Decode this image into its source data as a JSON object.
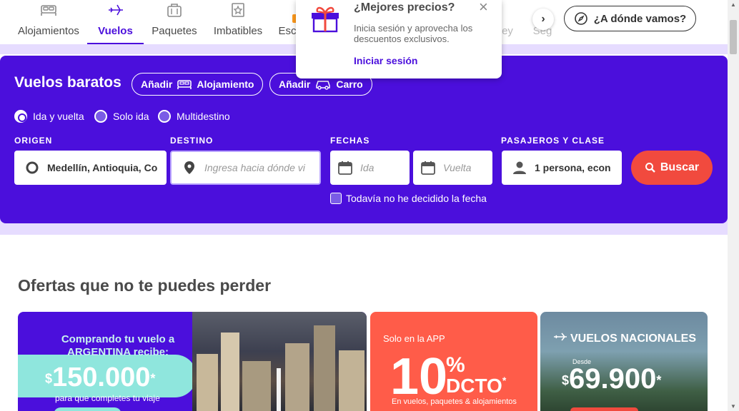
{
  "nav": {
    "items": [
      {
        "label": "Alojamientos",
        "icon": "bed-icon"
      },
      {
        "label": "Vuelos",
        "icon": "plane-icon",
        "active": true
      },
      {
        "label": "Paquetes",
        "icon": "luggage-icon"
      },
      {
        "label": "Imbatibles",
        "icon": "badge-icon"
      },
      {
        "label": "Esc",
        "icon": "escape-icon"
      }
    ],
    "faded_items": [
      "ey",
      "Seg"
    ],
    "arrow": "›",
    "where_button": "¿A dónde vamos?"
  },
  "popup": {
    "title": "¿Mejores precios?",
    "description": "Inicia sesión y aprovecha los descuentos exclusivos.",
    "link": "Iniciar sesión",
    "close": "×"
  },
  "search": {
    "title": "Vuelos baratos",
    "add_label": "Añadir",
    "add_lodging": "Alojamiento",
    "add_car": "Carro",
    "trip_types": [
      "Ida y vuelta",
      "Solo ida",
      "Multidestino"
    ],
    "origin_label": "ORIGEN",
    "origin_value": "Medellín, Antioquia, Co",
    "destination_label": "DESTINO",
    "destination_placeholder": "Ingresa hacia dónde vi",
    "dates_label": "FECHAS",
    "departure_placeholder": "Ida",
    "return_placeholder": "Vuelta",
    "passengers_label": "PASAJEROS Y CLASE",
    "passengers_value": "1 persona, econ",
    "search_button": "Buscar",
    "undecided_label": "Todavía no he decidido la fecha"
  },
  "offers": {
    "title": "Ofertas que no te puedes perder",
    "card1": {
      "headline": "Comprando tu vuelo a ARGENTINA recibe:",
      "currency": "$",
      "amount": "150.000",
      "asterisk": "*",
      "subtitle": "para que completes tu viaje"
    },
    "card2": {
      "app_label": "Solo en la APP",
      "number": "10",
      "percent": "%",
      "dcto": "DCTO",
      "asterisk": "*",
      "detail": "En vuelos, paquetes & alojamientos"
    },
    "card3": {
      "headline": "VUELOS NACIONALES",
      "from": "Desde",
      "currency": "$",
      "price": "69.900",
      "asterisk": "*"
    }
  },
  "colors": {
    "brand_purple": "#4b0fdc",
    "accent_red": "#f14a3e",
    "lavender": "#e6dcff"
  }
}
